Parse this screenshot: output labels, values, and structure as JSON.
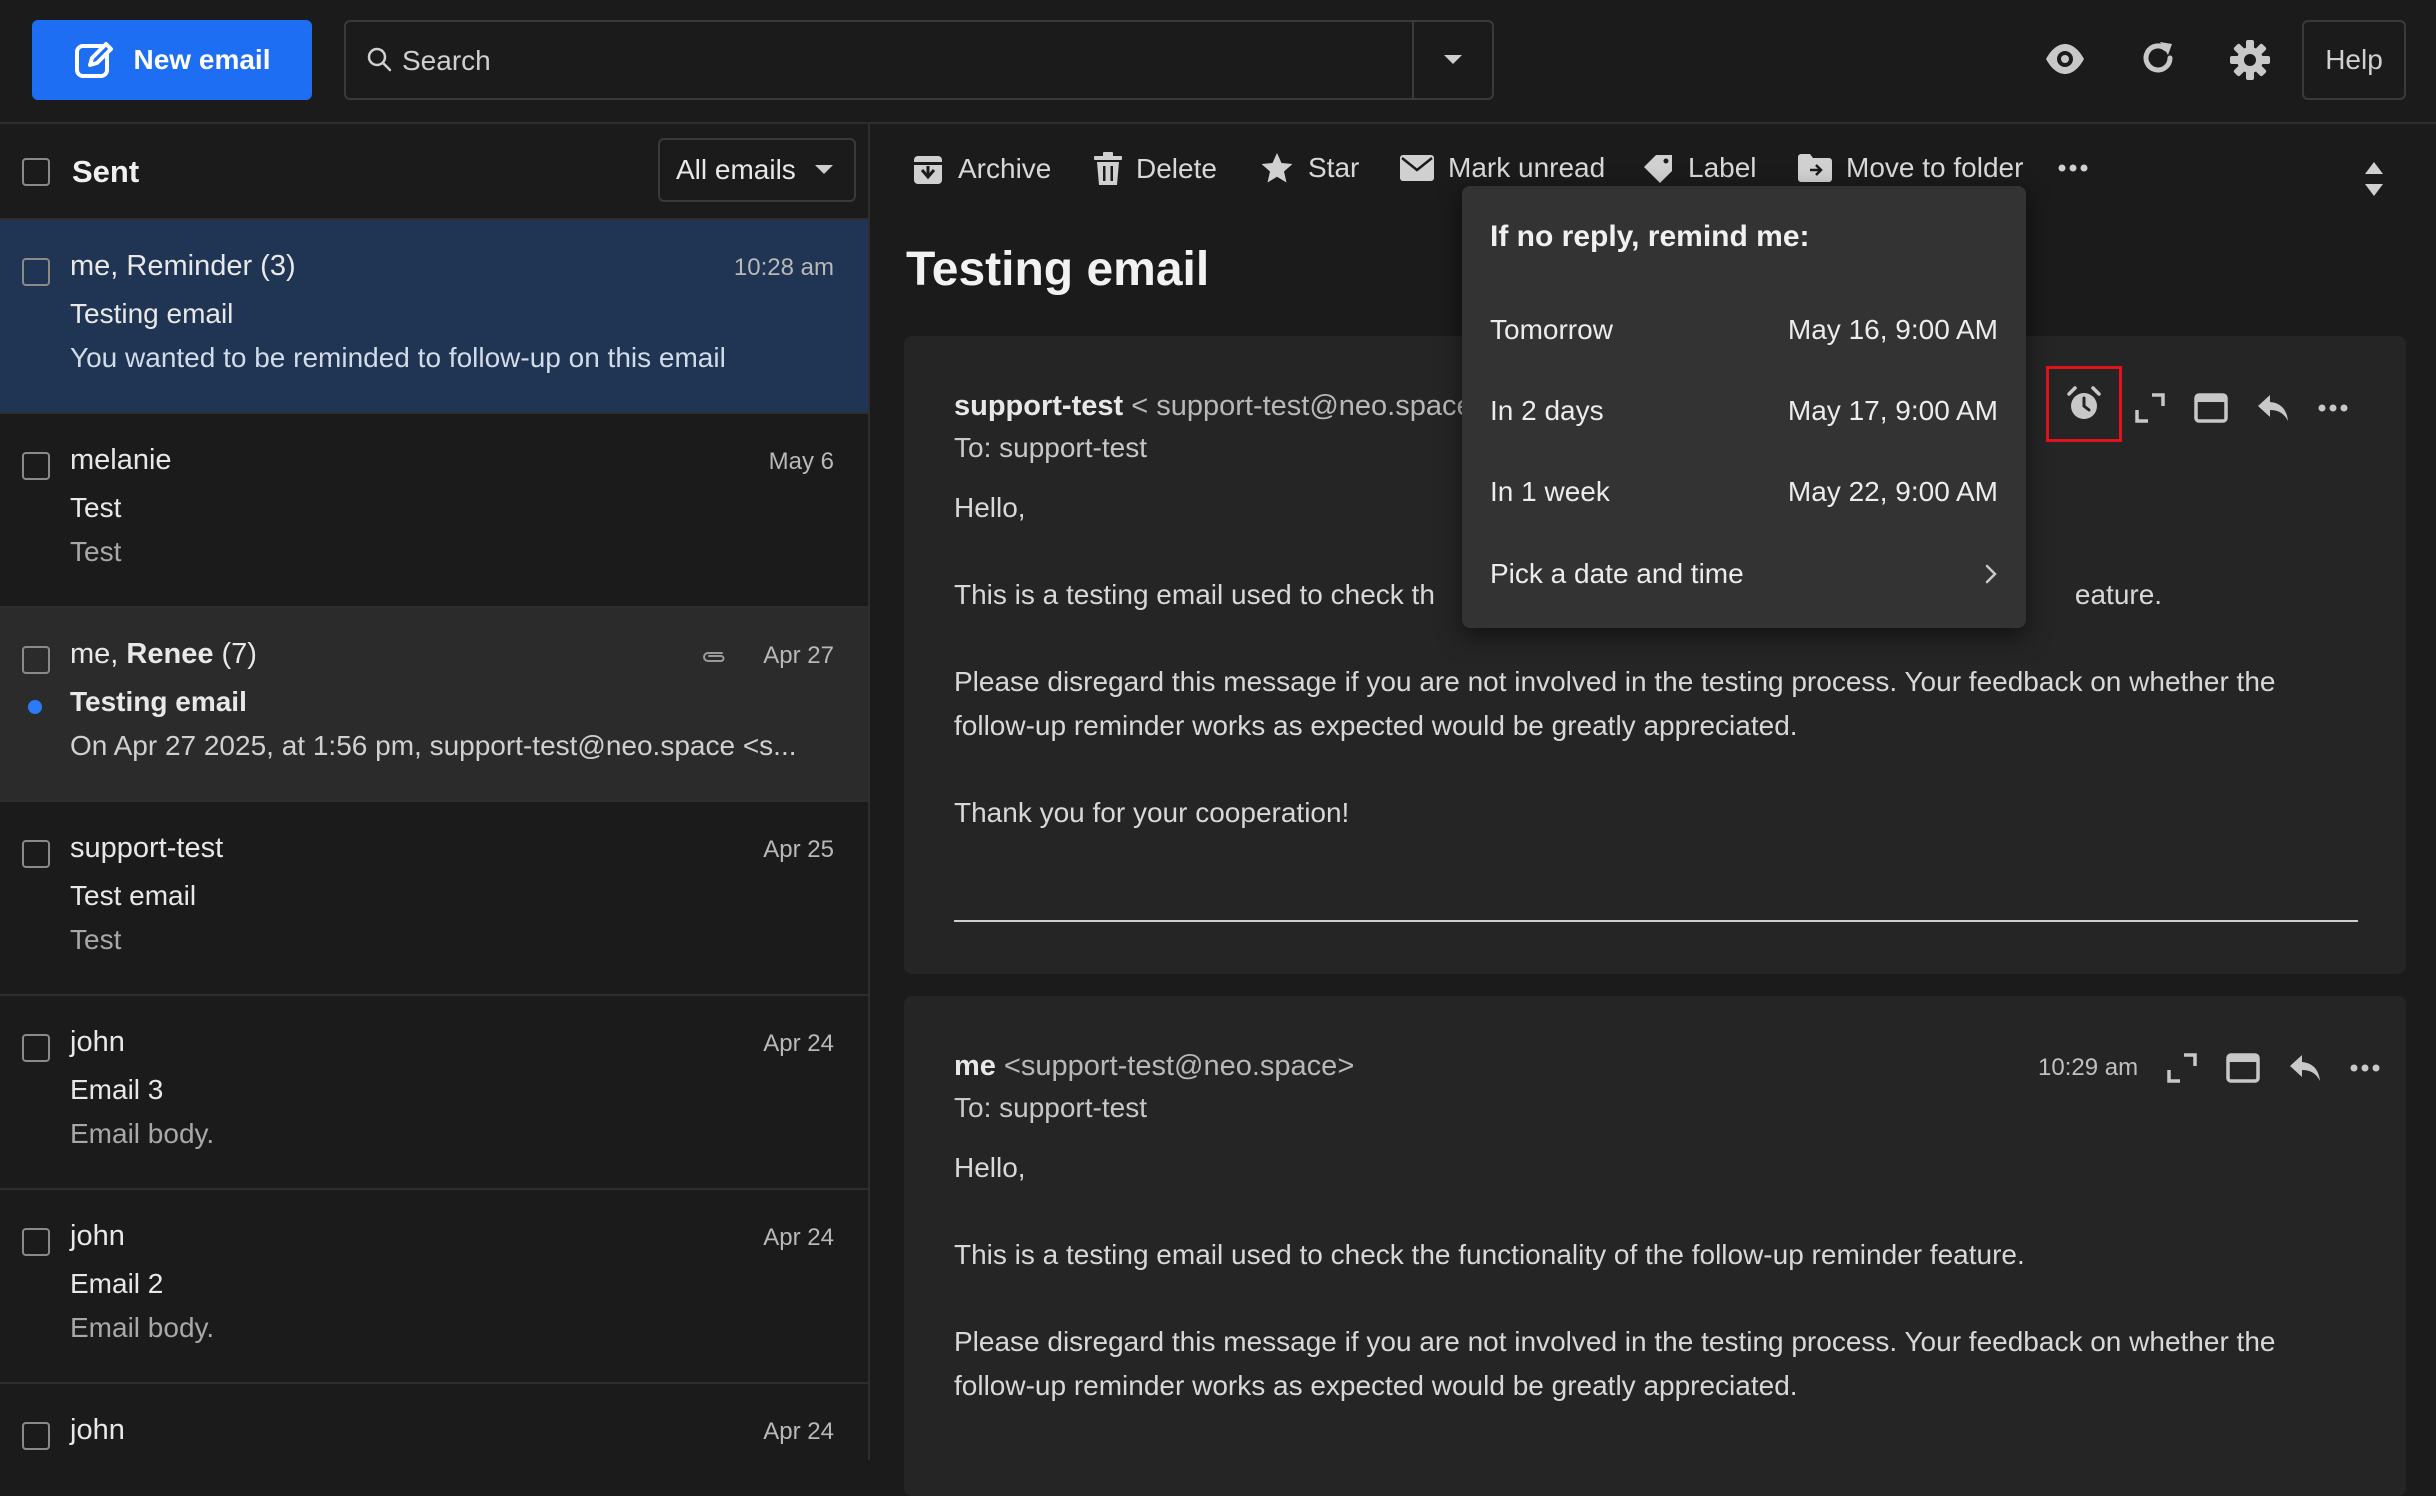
{
  "topbar": {
    "new_email_label": "New email",
    "search_placeholder": "Search",
    "help_label": "Help"
  },
  "folder": {
    "title": "Sent",
    "filter": "All emails"
  },
  "emails": [
    {
      "sender": "me, Reminder (3)",
      "date": "10:28 am",
      "subject": "Testing email",
      "preview": "You wanted to be reminded to follow-up on this email"
    },
    {
      "sender": "melanie",
      "date": "May 6",
      "subject": "Test",
      "preview": "Test"
    },
    {
      "sender_prefix": "me, ",
      "sender_bold": "Renee",
      "sender_suffix": " (7)",
      "date": "Apr 27",
      "subject": "Testing email",
      "preview": "On Apr 27 2025, at 1:56 pm, support-test@neo.space <s..."
    },
    {
      "sender": "support-test",
      "date": "Apr 25",
      "subject": "Test email",
      "preview": "Test"
    },
    {
      "sender": "john",
      "date": "Apr 24",
      "subject": "Email 3",
      "preview": "Email body."
    },
    {
      "sender": "john",
      "date": "Apr 24",
      "subject": "Email 2",
      "preview": "Email body."
    },
    {
      "sender": "john",
      "date": "Apr 24"
    }
  ],
  "toolbar": {
    "archive": "Archive",
    "delete": "Delete",
    "star": "Star",
    "mark_unread": "Mark unread",
    "label": "Label",
    "move_to_folder": "Move to folder"
  },
  "thread": {
    "title": "Testing email",
    "messages": [
      {
        "from_name": "support-test",
        "from_addr": "< support-test@neo.space",
        "to": "To: support-test",
        "greeting": "Hello,",
        "para1_start": "This is a testing email used to check th",
        "para1_end": "eature.",
        "para2": "Please disregard this message if you are not involved in the testing process. Your feedback on whether the follow-up reminder works as expected would be greatly appreciated.",
        "closing": "Thank you for your cooperation!"
      },
      {
        "from_name": "me",
        "from_addr": "<support-test@neo.space>",
        "time": "10:29 am",
        "to": "To: support-test",
        "greeting": "Hello,",
        "para1": "This is a testing email used to check the functionality of the follow-up reminder feature.",
        "para2": "Please disregard this message if you are not involved in the testing process. Your feedback on whether the follow-up reminder works as expected would be greatly appreciated."
      }
    ]
  },
  "remind_popup": {
    "title": "If no reply, remind me:",
    "options": [
      {
        "label": "Tomorrow",
        "value": "May 16, 9:00 AM"
      },
      {
        "label": "In 2 days",
        "value": "May 17, 9:00 AM"
      },
      {
        "label": "In 1 week",
        "value": "May 22, 9:00 AM"
      },
      {
        "label": "Pick a date and time"
      }
    ]
  },
  "colors": {
    "accent": "#1d6ef2",
    "selected_row": "#1f3553",
    "highlight_box": "#e0121b",
    "unread_dot": "#2a7cf6"
  }
}
